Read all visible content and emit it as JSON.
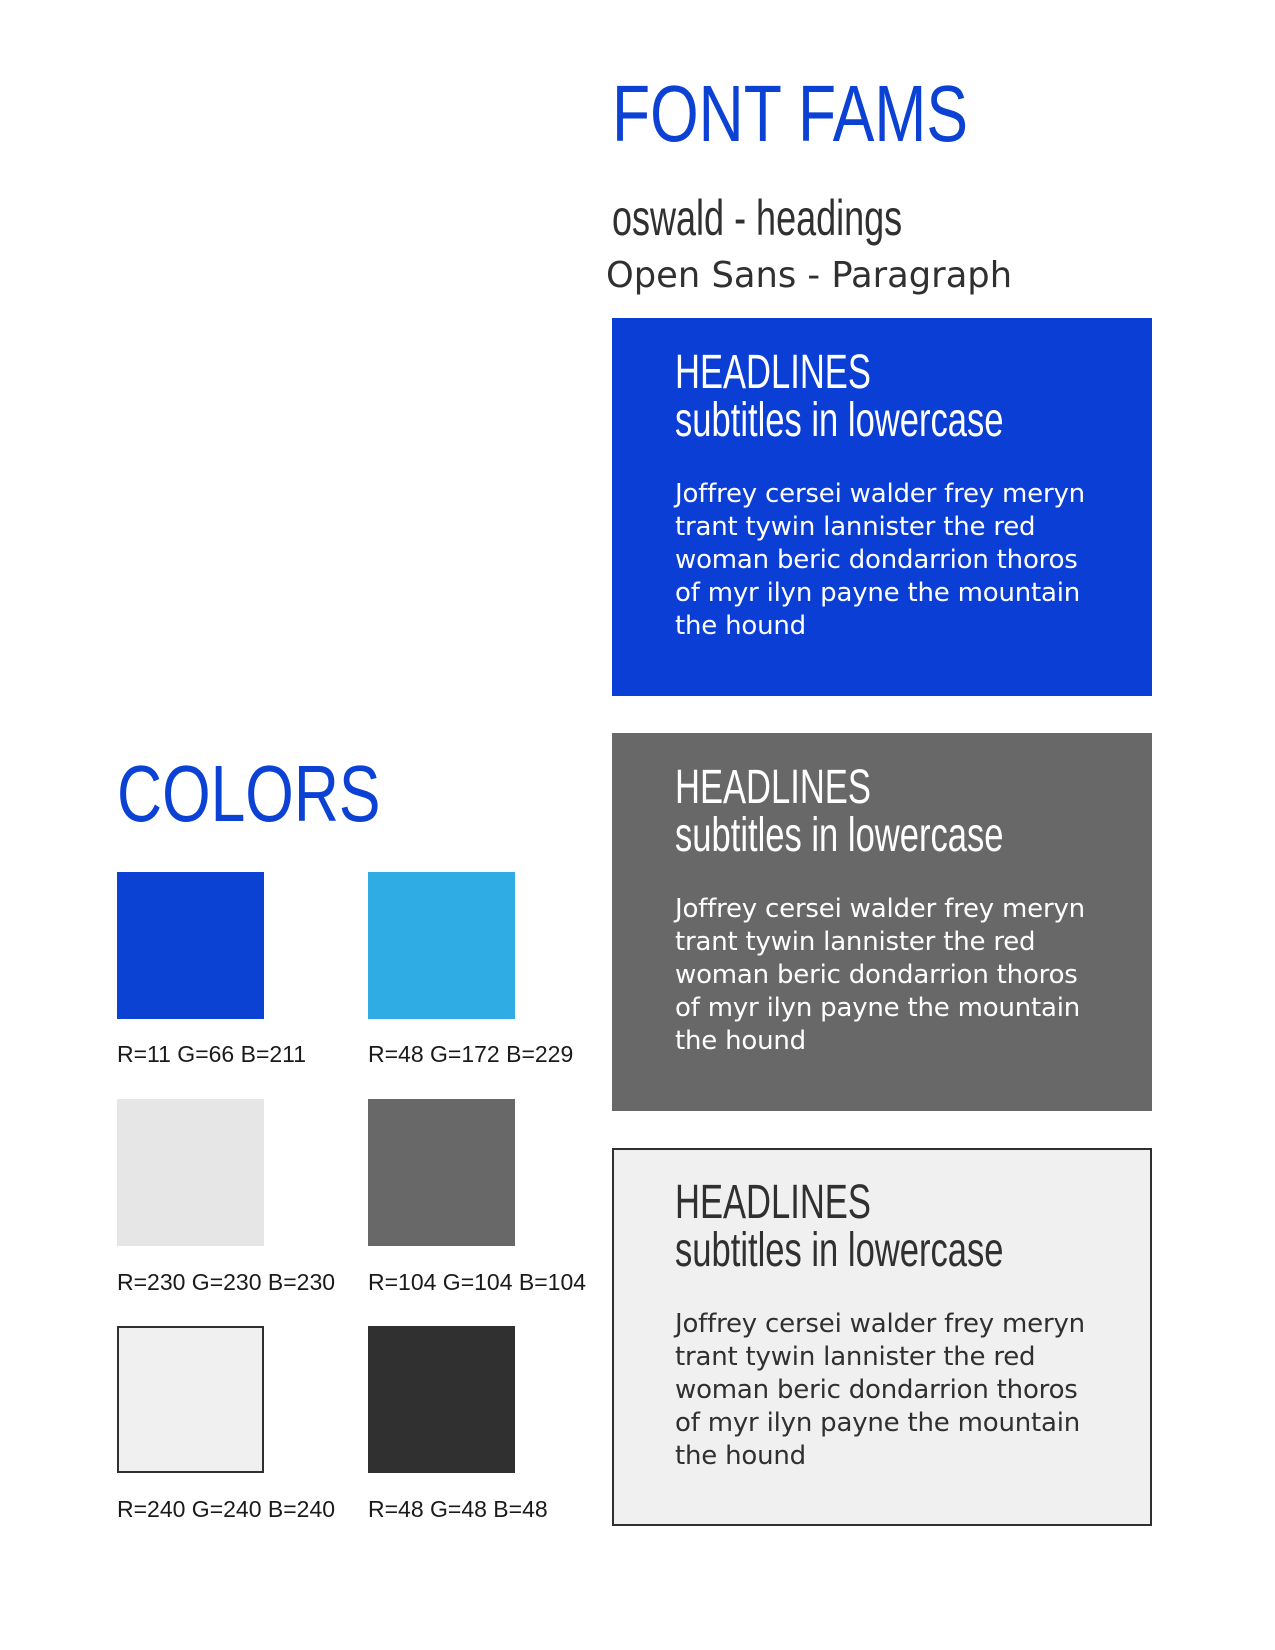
{
  "font_section": {
    "title": "FONT FAMS",
    "heading_font_sample": "oswald - headings",
    "paragraph_font_sample": "Open Sans - Paragraph"
  },
  "sample_cards": [
    {
      "variant": "blue",
      "background": "#0b3ed5",
      "headline": "HEADLINES",
      "subtitle": "subtitles in lowercase",
      "paragraph": "Joffrey cersei walder frey meryn trant tywin lannister the red woman beric dondarrion thoros of myr ilyn payne the mountain the hound"
    },
    {
      "variant": "grey",
      "background": "#686868",
      "headline": "HEADLINES",
      "subtitle": "subtitles in lowercase",
      "paragraph": "Joffrey cersei walder frey meryn trant tywin lannister the red woman beric dondarrion thoros of myr ilyn payne the mountain the hound"
    },
    {
      "variant": "light",
      "background": "#f0f0f0",
      "headline": "HEADLINES",
      "subtitle": "subtitles in lowercase",
      "paragraph": "Joffrey cersei walder frey meryn trant tywin lannister the red woman beric dondarrion thoros of myr ilyn payne the mountain the hound"
    }
  ],
  "colors_section": {
    "title": "COLORS",
    "swatches": [
      {
        "hex": "#0b42d3",
        "label": "R=11 G=66 B=211"
      },
      {
        "hex": "#30ace5",
        "label": "R=48 G=172 B=229"
      },
      {
        "hex": "#e6e6e6",
        "label": "R=230 G=230 B=230"
      },
      {
        "hex": "#686868",
        "label": "R=104 G=104 B=104"
      },
      {
        "hex": "#f0f0f0",
        "label": "R=240 G=240 B=240"
      },
      {
        "hex": "#303030",
        "label": "R=48 G=48 B=48"
      }
    ]
  },
  "colors": {
    "accent_blue": "#0b42d3",
    "text_dark": "#303030"
  }
}
